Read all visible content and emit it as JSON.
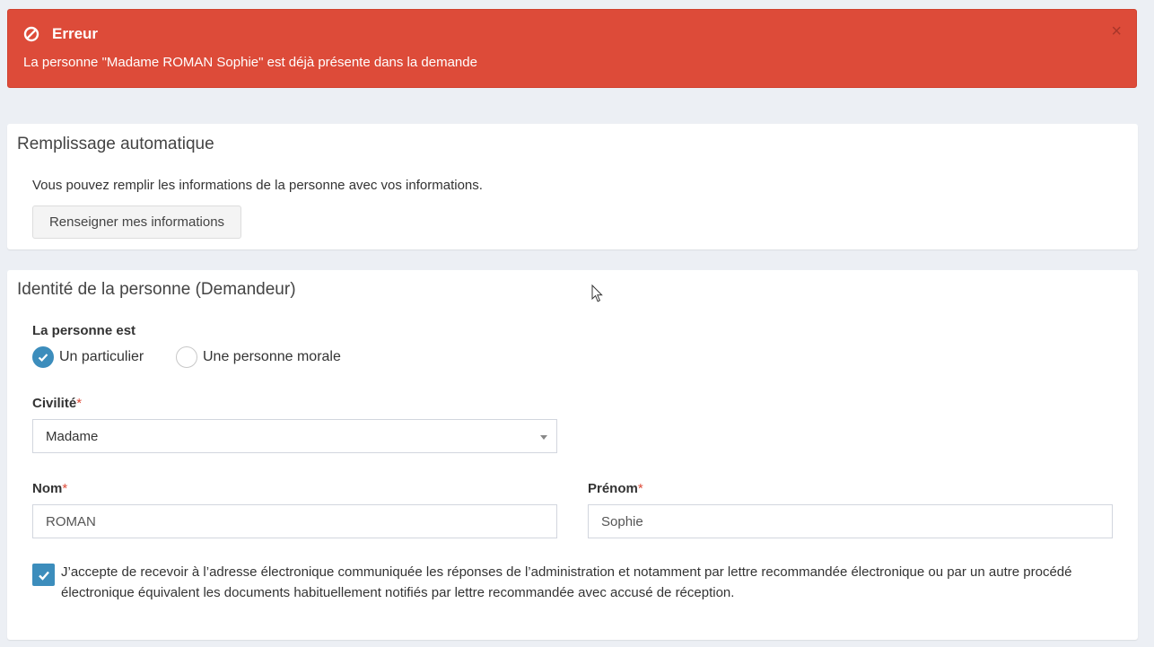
{
  "alert": {
    "title": "Erreur",
    "message": "La personne \"Madame ROMAN Sophie\" est déjà présente dans la demande",
    "close": "×",
    "color": "#dd4b39",
    "icon": "ban-icon"
  },
  "auto_fill": {
    "title": "Remplissage automatique",
    "text": "Vous pouvez remplir les informations de la personne avec vos informations.",
    "button": "Renseigner mes informations"
  },
  "identity": {
    "title": "Identité de la personne (Demandeur)",
    "person_type_label": "La personne est",
    "options": [
      {
        "label": "Un particulier",
        "checked": true
      },
      {
        "label": "Une personne morale",
        "checked": false
      }
    ],
    "civility": {
      "label": "Civilité",
      "required_mark": "*",
      "value": "Madame"
    },
    "last_name": {
      "label": "Nom",
      "required_mark": "*",
      "value": "ROMAN"
    },
    "first_name": {
      "label": "Prénom",
      "required_mark": "*",
      "value": "Sophie"
    },
    "consent": {
      "checked": true,
      "text": "J’accepte de recevoir à l’adresse électronique communiquée les réponses de l’administration et notamment par lettre recommandée électronique ou par un autre procédé électronique équivalent les documents habituellement notifiés par lettre recommandée avec accusé de réception."
    }
  },
  "accent_color": "#3c8dbc"
}
